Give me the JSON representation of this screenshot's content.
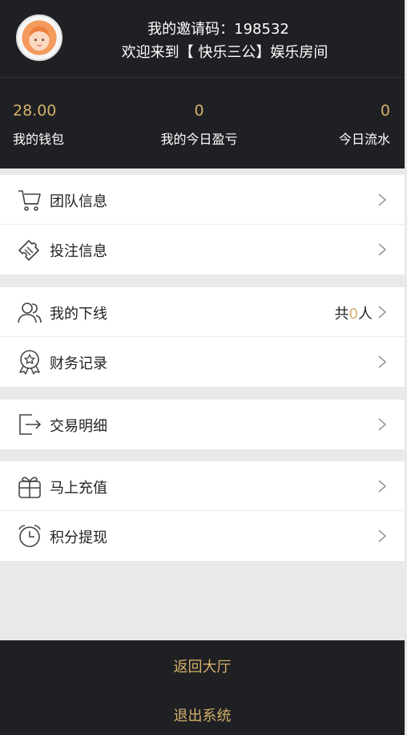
{
  "header": {
    "invite_line": "我的邀请码：198532",
    "welcome_line": "欢迎来到【 快乐三公】娱乐房间"
  },
  "stats": [
    {
      "value": "28.00",
      "label": "我的钱包"
    },
    {
      "value": "0",
      "label": "我的今日盈亏"
    },
    {
      "value": "0",
      "label": "今日流水"
    }
  ],
  "menu": {
    "team_info": "团队信息",
    "bet_info": "投注信息",
    "my_downline": "我的下线",
    "downline_count_prefix": "共",
    "downline_count": "0",
    "downline_count_suffix": "人",
    "finance_records": "财务记录",
    "transaction_details": "交易明细",
    "recharge": "马上充值",
    "withdraw": "积分提现"
  },
  "footer": {
    "back_to_lobby": "返回大厅",
    "logout": "退出系统"
  },
  "colors": {
    "dark_bg": "#1f2024",
    "accent_gold": "#d4b06a",
    "page_bg": "#e9e9e9"
  }
}
